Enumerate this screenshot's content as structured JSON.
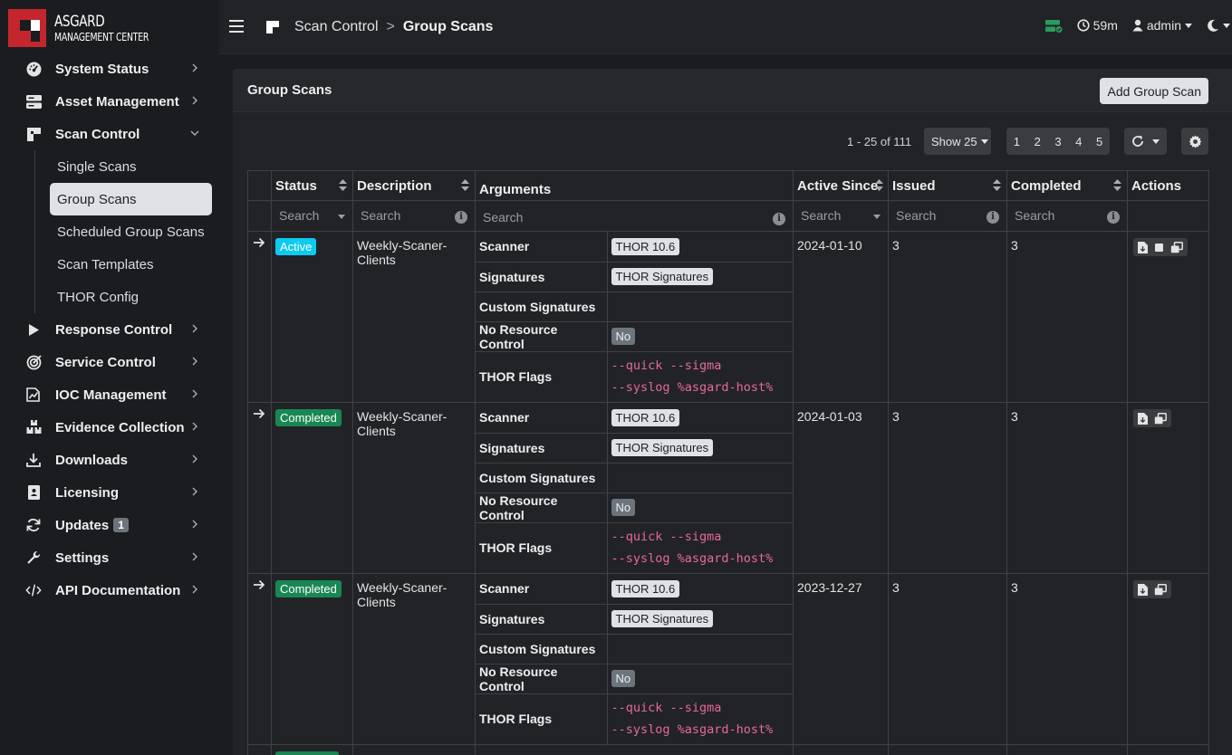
{
  "brand": {
    "line1": "ASGARD",
    "line2": "MANAGEMENT CENTER"
  },
  "nav": [
    {
      "label": "System Status",
      "icon": "gauge-icon"
    },
    {
      "label": "Asset Management",
      "icon": "server-icon"
    },
    {
      "label": "Scan Control",
      "icon": "scan-icon",
      "expanded": true
    },
    {
      "label": "Response Control",
      "icon": "play-icon"
    },
    {
      "label": "Service Control",
      "icon": "target-icon"
    },
    {
      "label": "IOC Management",
      "icon": "file-chart-icon"
    },
    {
      "label": "Evidence Collection",
      "icon": "boxes-icon"
    },
    {
      "label": "Downloads",
      "icon": "download-icon"
    },
    {
      "label": "Licensing",
      "icon": "id-card-icon"
    },
    {
      "label": "Updates",
      "icon": "sync-icon",
      "badge": "1"
    },
    {
      "label": "Settings",
      "icon": "wrench-icon"
    },
    {
      "label": "API Documentation",
      "icon": "code-icon"
    }
  ],
  "scan_sub": [
    "Single Scans",
    "Group Scans",
    "Scheduled Group Scans",
    "Scan Templates",
    "THOR Config"
  ],
  "topbar": {
    "crumb_parent": "Scan Control",
    "crumb_sep": ">",
    "crumb_current": "Group Scans",
    "timer": "59m",
    "user": "admin"
  },
  "card": {
    "title": "Group Scans",
    "add_button": "Add Group Scan"
  },
  "toolbar": {
    "range": "1 - 25 of 111",
    "show": "Show 25",
    "pages": [
      "1",
      "2",
      "3",
      "4",
      "5"
    ]
  },
  "columns": {
    "status": "Status",
    "description": "Description",
    "arguments": "Arguments",
    "active_since": "Active Since",
    "issued": "Issued",
    "completed": "Completed",
    "actions": "Actions"
  },
  "filter_placeholder": "Search",
  "arg_labels": {
    "scanner": "Scanner",
    "signatures": "Signatures",
    "custom": "Custom Signatures",
    "noresource": "No Resource Control",
    "flags": "THOR Flags"
  },
  "rows": [
    {
      "status": "Active",
      "description": "Weekly-Scaner-Clients",
      "scanner": "THOR 10.6",
      "signatures": "THOR Signatures",
      "custom": "",
      "noresource": "No",
      "flags": "--quick --sigma\n--syslog %asgard-host%",
      "active_since": "2024-01-10",
      "issued": "3",
      "completed": "3"
    },
    {
      "status": "Completed",
      "description": "Weekly-Scaner-Clients",
      "scanner": "THOR 10.6",
      "signatures": "THOR Signatures",
      "custom": "",
      "noresource": "No",
      "flags": "--quick --sigma\n--syslog %asgard-host%",
      "active_since": "2024-01-03",
      "issued": "3",
      "completed": "3"
    },
    {
      "status": "Completed",
      "description": "Weekly-Scaner-Clients",
      "scanner": "THOR 10.6",
      "signatures": "THOR Signatures",
      "custom": "",
      "noresource": "No",
      "flags": "--quick --sigma\n--syslog %asgard-host%",
      "active_since": "2023-12-27",
      "issued": "3",
      "completed": "3"
    }
  ],
  "colors": {
    "accent_red": "#c4262e",
    "status_active": "#0dcaf0",
    "status_completed": "#198754",
    "flags_pink": "#e46a9c"
  }
}
